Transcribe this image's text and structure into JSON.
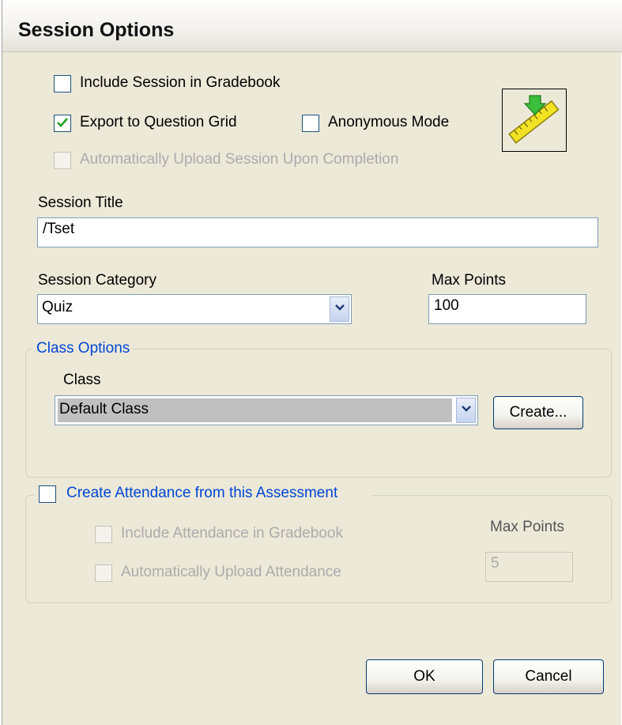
{
  "window": {
    "title": "Session Options"
  },
  "options": {
    "include_gradebook": {
      "label": "Include Session in Gradebook",
      "checked": false
    },
    "export_question_grid": {
      "label": "Export to Question Grid",
      "checked": true
    },
    "anonymous_mode": {
      "label": "Anonymous Mode",
      "checked": false
    },
    "auto_upload": {
      "label": "Automatically Upload Session Upon Completion",
      "checked": false,
      "disabled": true
    }
  },
  "icon": "ruler-pencil-icon",
  "session_title": {
    "label": "Session Title",
    "value": "/Tset"
  },
  "session_category": {
    "label": "Session Category",
    "value": "Quiz"
  },
  "max_points": {
    "label": "Max Points",
    "value": "100"
  },
  "class_options": {
    "legend": "Class Options",
    "class_label": "Class",
    "class_value": "Default Class",
    "create_button": "Create..."
  },
  "attendance": {
    "legend": "Create Attendance from this Assessment",
    "checked": false,
    "include_gradebook": "Include Attendance in Gradebook",
    "auto_upload": "Automatically Upload Attendance",
    "max_points_label": "Max Points",
    "max_points_value": "5"
  },
  "buttons": {
    "ok": "OK",
    "cancel": "Cancel"
  },
  "colors": {
    "accent_blue": "#0046d5",
    "window_bg": "#ece9d8",
    "check_green": "#21a121"
  }
}
